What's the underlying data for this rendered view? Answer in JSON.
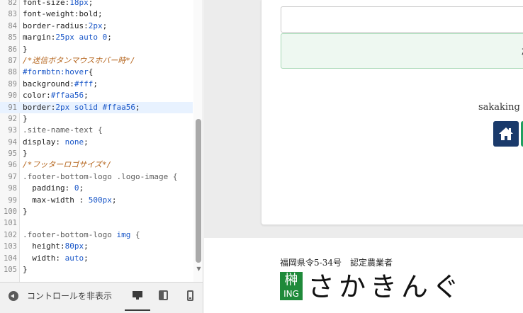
{
  "editor": {
    "lines": [
      {
        "num": "82",
        "segments": [
          {
            "t": "font-size:",
            "c": "prop"
          },
          {
            "t": "18px",
            "c": "val"
          },
          {
            "t": ";",
            "c": "punc"
          }
        ]
      },
      {
        "num": "83",
        "segments": [
          {
            "t": "font-weight:",
            "c": "prop"
          },
          {
            "t": "bold",
            "c": "prop"
          },
          {
            "t": ";",
            "c": "punc"
          }
        ]
      },
      {
        "num": "84",
        "segments": [
          {
            "t": "border-radius:",
            "c": "prop"
          },
          {
            "t": "2px",
            "c": "val"
          },
          {
            "t": ";",
            "c": "punc"
          }
        ]
      },
      {
        "num": "85",
        "segments": [
          {
            "t": "margin:",
            "c": "prop"
          },
          {
            "t": "25px auto 0",
            "c": "val"
          },
          {
            "t": ";",
            "c": "punc"
          }
        ]
      },
      {
        "num": "86",
        "segments": [
          {
            "t": "}",
            "c": "punc"
          }
        ]
      },
      {
        "num": "87",
        "segments": [
          {
            "t": "/*送信ボタンマウスホバー時*/",
            "c": "com"
          }
        ]
      },
      {
        "num": "88",
        "segments": [
          {
            "t": "#formbtn:hover",
            "c": "sel"
          },
          {
            "t": "{",
            "c": "punc"
          }
        ]
      },
      {
        "num": "89",
        "segments": [
          {
            "t": "background:",
            "c": "prop"
          },
          {
            "t": "#fff",
            "c": "hex"
          },
          {
            "t": ";",
            "c": "punc"
          }
        ]
      },
      {
        "num": "90",
        "segments": [
          {
            "t": "color:",
            "c": "prop"
          },
          {
            "t": "#ffaa56",
            "c": "hex"
          },
          {
            "t": ";",
            "c": "punc"
          }
        ]
      },
      {
        "num": "91",
        "segments": [
          {
            "t": "border:",
            "c": "prop"
          },
          {
            "t": "2px solid #ffaa56",
            "c": "val"
          },
          {
            "t": ";",
            "c": "punc"
          }
        ],
        "active": true
      },
      {
        "num": "92",
        "segments": [
          {
            "t": "}",
            "c": "punc"
          }
        ]
      },
      {
        "num": "93",
        "segments": [
          {
            "t": ".site-name-text {",
            "c": "cls"
          }
        ]
      },
      {
        "num": "94",
        "segments": [
          {
            "t": "display: ",
            "c": "prop"
          },
          {
            "t": "none",
            "c": "val"
          },
          {
            "t": ";",
            "c": "punc"
          }
        ]
      },
      {
        "num": "95",
        "segments": [
          {
            "t": "}",
            "c": "punc"
          }
        ]
      },
      {
        "num": "96",
        "segments": [
          {
            "t": "/*フッターロゴサイズ*/",
            "c": "com"
          }
        ]
      },
      {
        "num": "97",
        "segments": [
          {
            "t": ".footer-bottom-logo .logo-image {",
            "c": "cls"
          }
        ]
      },
      {
        "num": "98",
        "segments": [
          {
            "t": "  padding: ",
            "c": "prop"
          },
          {
            "t": "0",
            "c": "val"
          },
          {
            "t": ";",
            "c": "punc"
          }
        ]
      },
      {
        "num": "99",
        "segments": [
          {
            "t": "  max-width : ",
            "c": "prop"
          },
          {
            "t": "500px",
            "c": "val"
          },
          {
            "t": ";",
            "c": "punc"
          }
        ]
      },
      {
        "num": "100",
        "segments": [
          {
            "t": "}",
            "c": "punc"
          }
        ]
      },
      {
        "num": "101",
        "segments": []
      },
      {
        "num": "102",
        "segments": [
          {
            "t": ".footer-bottom-logo ",
            "c": "cls"
          },
          {
            "t": "img",
            "c": "sel"
          },
          {
            "t": " {",
            "c": "cls"
          }
        ]
      },
      {
        "num": "103",
        "segments": [
          {
            "t": "  height:",
            "c": "prop"
          },
          {
            "t": "80px",
            "c": "val"
          },
          {
            "t": ";",
            "c": "punc"
          }
        ]
      },
      {
        "num": "104",
        "segments": [
          {
            "t": "  width: ",
            "c": "prop"
          },
          {
            "t": "auto",
            "c": "val"
          },
          {
            "t": ";",
            "c": "punc"
          }
        ]
      },
      {
        "num": "105",
        "segments": [
          {
            "t": "}",
            "c": "punc"
          }
        ]
      }
    ]
  },
  "controls": {
    "hide_label": "コントロールを非表示",
    "hide_icon": "chevron-left-circle-icon",
    "device_icons": [
      "desktop-icon",
      "tablet-icon",
      "mobile-icon"
    ],
    "selected_device": "desktop"
  },
  "preview": {
    "submit_label": "確",
    "copyright": "sakaking ©",
    "home_icon": "home-icon",
    "footer": {
      "cert_text": "福岡県令5-34号　認定農業者",
      "logo_kanji": "榊",
      "logo_ing": "ING",
      "wordmark": "さかきんぐ"
    }
  },
  "colors": {
    "home_button": "#1a3a6b",
    "logo_green": "#1f8a3a",
    "submit_bg": "#eef8f1",
    "active_line": "#e8f2ff"
  }
}
